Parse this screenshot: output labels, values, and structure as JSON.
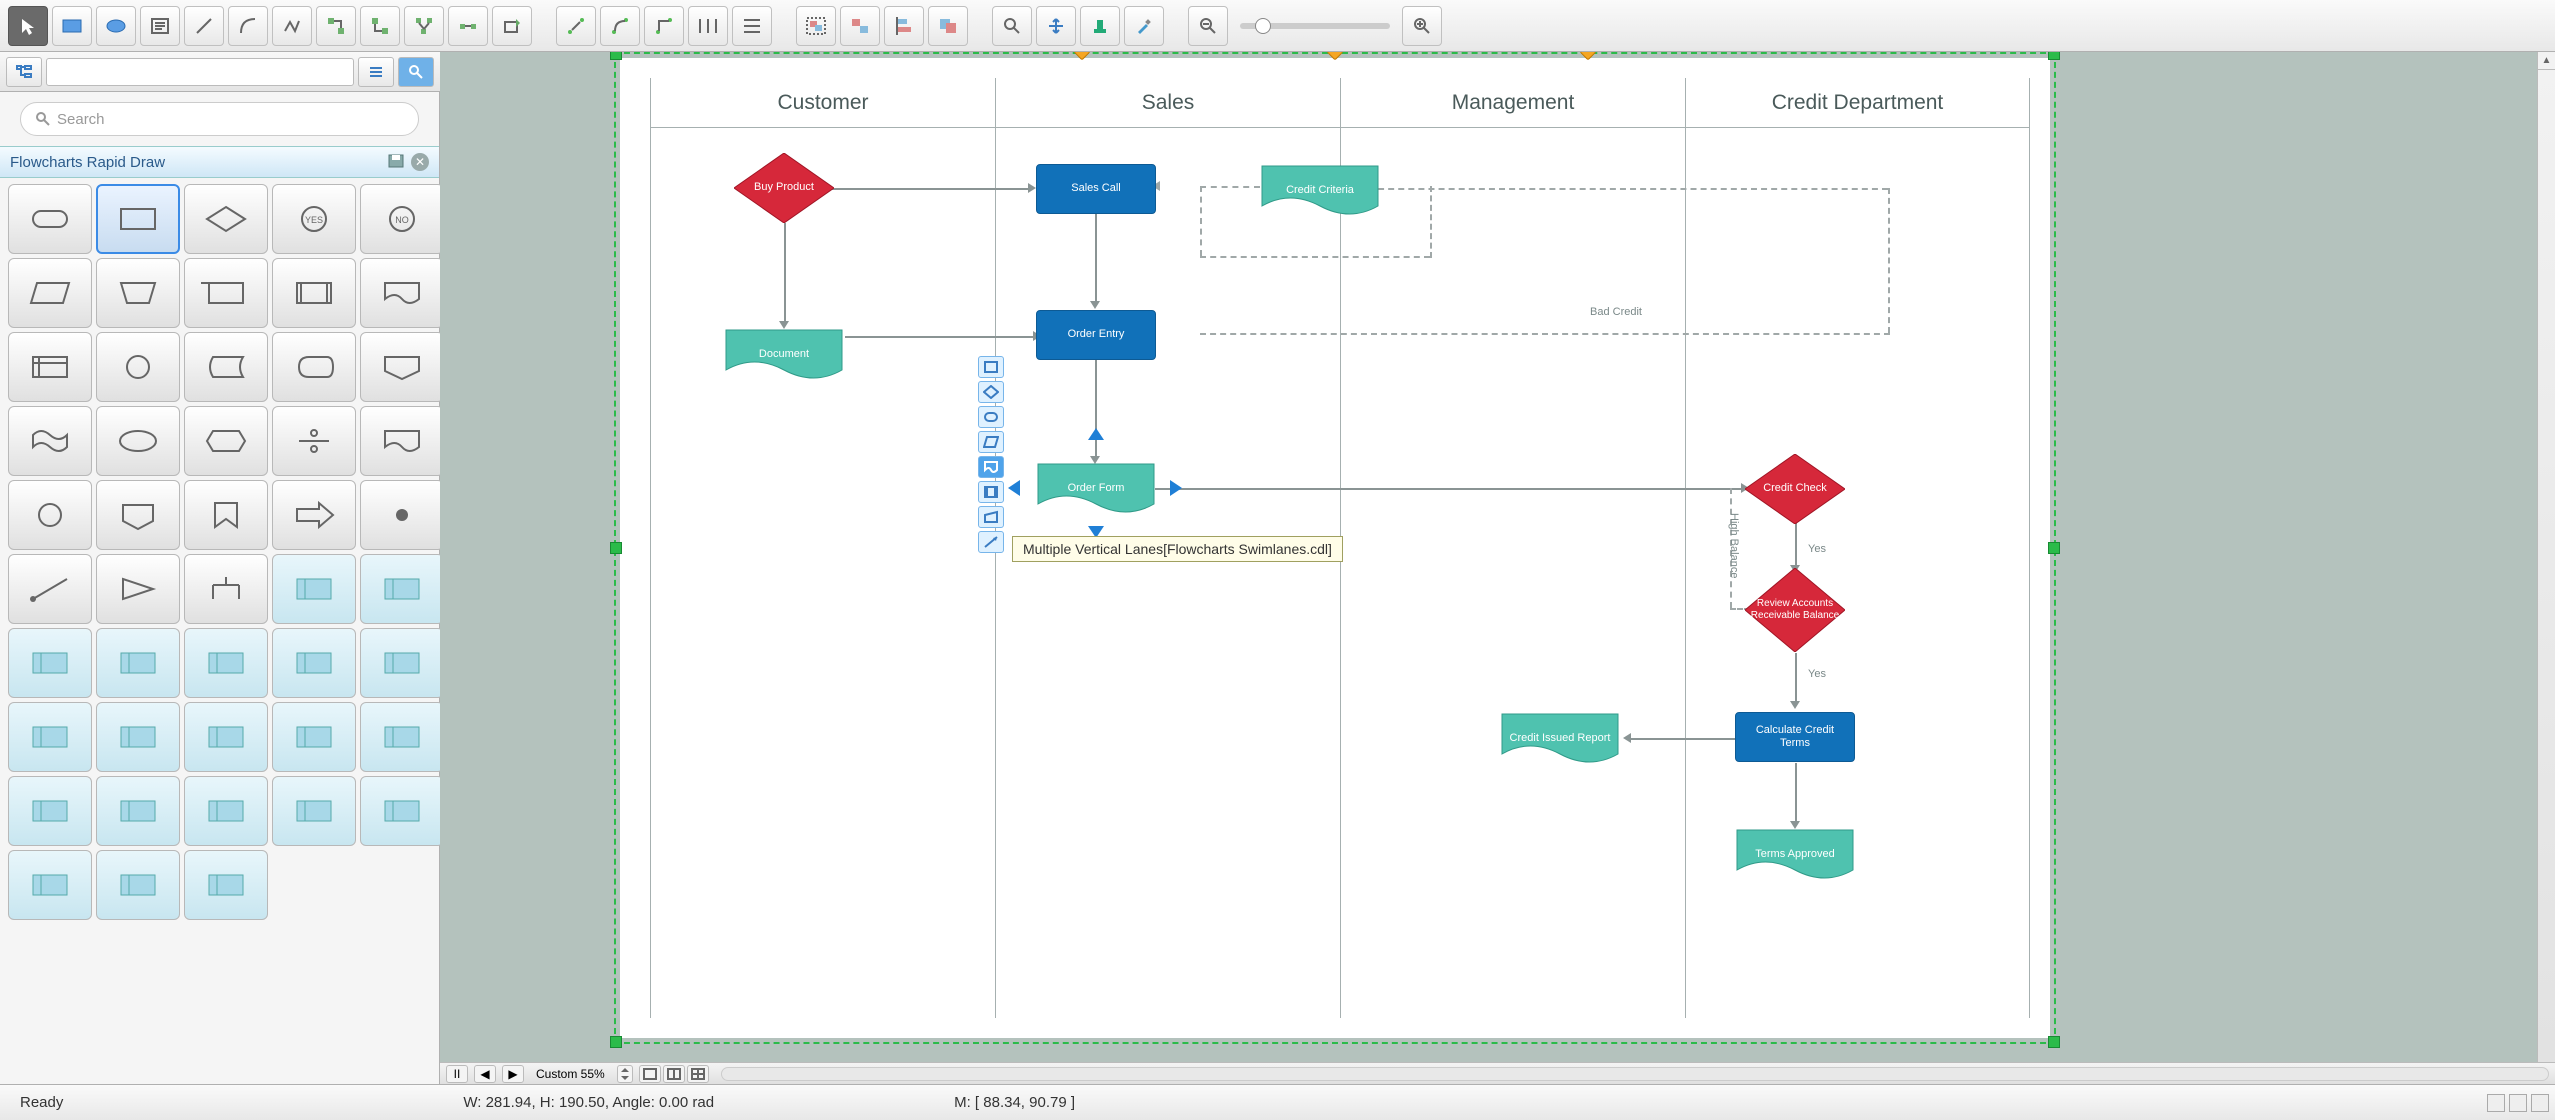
{
  "toolbar": {
    "tools": [
      "pointer",
      "rect",
      "ellipse",
      "text-block",
      "line",
      "arc",
      "polyline",
      "ortho-connector",
      "smart-connector",
      "multi-connector",
      "route-connector",
      "insert-shape"
    ],
    "conn_tools": [
      "conn-direct",
      "conn-curve",
      "conn-step",
      "conn-distribute-h",
      "conn-distribute-v"
    ],
    "group_tools": [
      "group",
      "ungroup",
      "align",
      "order"
    ],
    "view_tools": [
      "zoom",
      "pan",
      "stamp",
      "eyedropper"
    ],
    "zoom_out": "-",
    "zoom_in": "+"
  },
  "secbar": {
    "btn1": "outline-tree",
    "btn2": "outline-list",
    "btn3": "search-icon"
  },
  "search": {
    "placeholder": "Search"
  },
  "panel": {
    "title": "Flowcharts Rapid Draw",
    "shapes": [
      "terminator",
      "process",
      "decision",
      "yes",
      "no",
      "data-io",
      "manual-op",
      "card",
      "predefined",
      "doc",
      "internal-storage",
      "circle-connector",
      "stored-data",
      "display",
      "offpage",
      "tape",
      "prep",
      "hexagon",
      "summing",
      "or",
      "disk",
      "offpage-down",
      "bookmark",
      "arrow-right",
      "dot",
      "line-start",
      "amp",
      "merge",
      "corner-lane-tl",
      "corner-lane-tr",
      "vlane-1",
      "vlane-2",
      "vlane-3",
      "hlane-1",
      "hlane-2",
      "vswim-a",
      "vswim-b",
      "vswim-c",
      "hswim-a",
      "hswim-b",
      "pool-a",
      "pool-b",
      "pool-c",
      "vbar-1",
      "vbar-2",
      "vgroup-1",
      "vgroup-2",
      "vgroup-3"
    ],
    "selected_index": 1
  },
  "swimlane": {
    "headers": [
      "Customer",
      "Sales",
      "Management",
      "Credit Department"
    ]
  },
  "nodes": {
    "buy_product": "Buy Product",
    "document": "Document",
    "sales_call": "Sales Call",
    "order_entry": "Order Entry",
    "order_form": "Order Form",
    "credit_criteria": "Credit Criteria",
    "credit_check": "Credit Check",
    "review_ar": "Review Accounts Receivable Balance",
    "calc_terms": "Calculate Credit Terms",
    "credit_issued": "Credit Issued Report",
    "terms_approved": "Terms Approved"
  },
  "edge_labels": {
    "bad_credit": "Bad Credit",
    "high_balance": "High Balance",
    "yes1": "Yes",
    "yes2": "Yes"
  },
  "tooltip": "Multiple Vertical Lanes[Flowcharts Swimlanes.cdl]",
  "hscroll": {
    "zoom_label": "Custom 55%"
  },
  "status": {
    "ready": "Ready",
    "dims": "W: 281.94,  H: 190.50,  Angle: 0.00 rad",
    "mouse": "M: [ 88.34, 90.79 ]"
  },
  "colors": {
    "teal": "#4fc2af",
    "blue": "#1171b9",
    "red": "#d6283a"
  }
}
